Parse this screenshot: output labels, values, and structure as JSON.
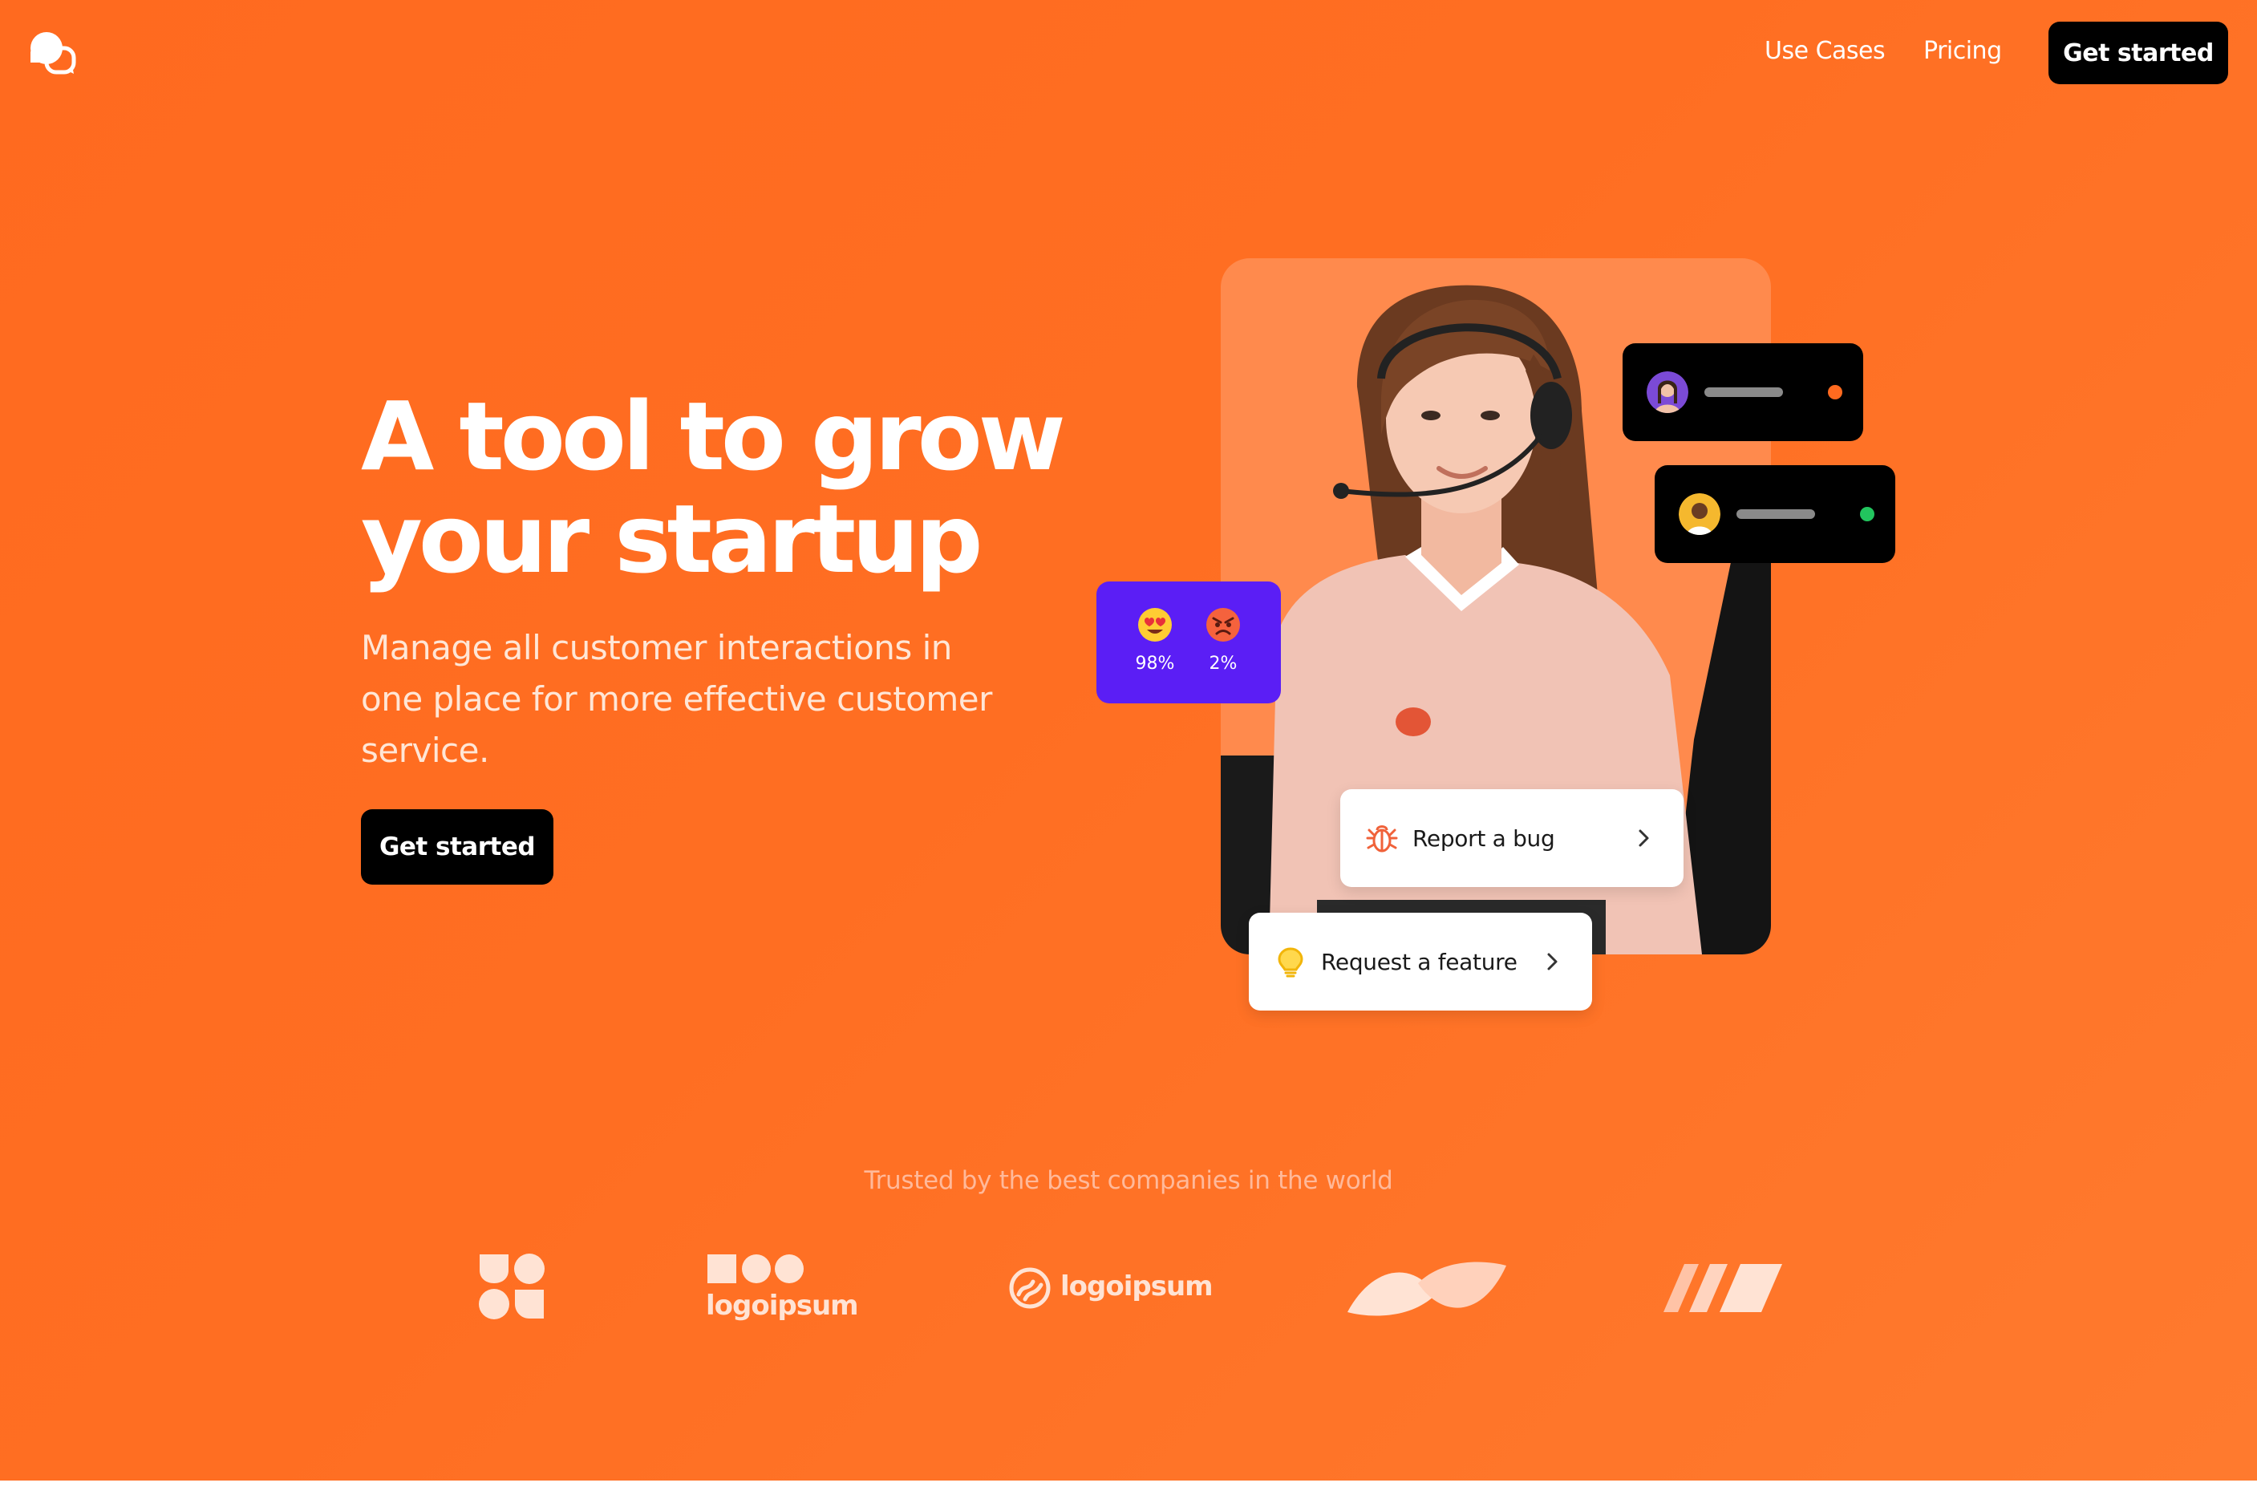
{
  "nav": {
    "use_cases": "Use Cases",
    "pricing": "Pricing",
    "cta": "Get started"
  },
  "hero": {
    "headline_line1": "A tool to grow",
    "headline_line2": "your startup",
    "subcopy": "Manage all customer interactions in one place for more effective customer service.",
    "cta": "Get started"
  },
  "visual": {
    "sentiment": {
      "positive_pct": "98%",
      "negative_pct": "2%"
    },
    "chats": [
      {
        "status_color": "#ff6a1f"
      },
      {
        "status_color": "#22c55e"
      }
    ],
    "actions": {
      "bug": "Report a bug",
      "feature": "Request a feature"
    }
  },
  "trusted": {
    "heading": "Trusted by the best companies in the world",
    "logos": [
      {
        "icon": "clover-logo-icon"
      },
      {
        "icon": "shapes-logo-icon",
        "text": "logoipsum"
      },
      {
        "icon": "circle-swirl-logo-icon",
        "text": "logoipsum"
      },
      {
        "icon": "wave-logo-icon"
      },
      {
        "icon": "slashes-logo-icon"
      }
    ]
  },
  "colors": {
    "brand_orange": "#ff6a1f",
    "sentiment_purple": "#5b1ef5",
    "button_black": "#000000"
  }
}
